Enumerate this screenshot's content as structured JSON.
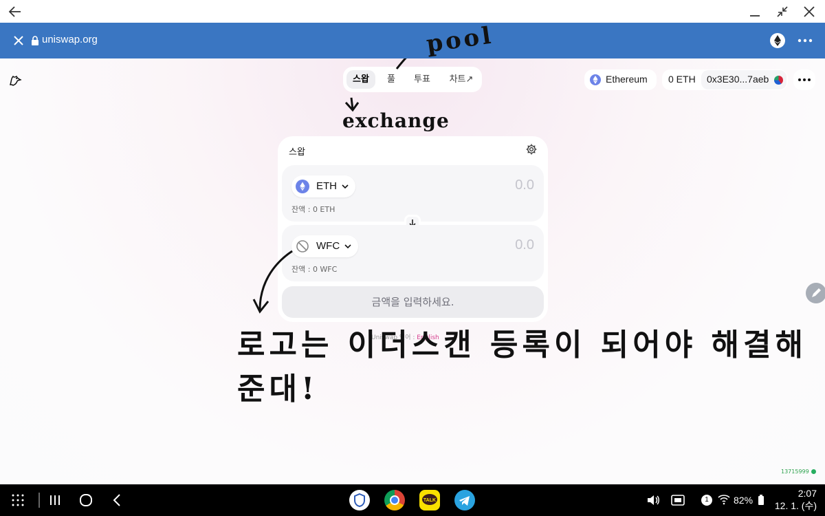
{
  "browser": {
    "url": "uniswap.org",
    "close_icon": "close-icon",
    "lock_icon": "lock-icon"
  },
  "nav": {
    "tabs": [
      {
        "label": "스왑",
        "active": true
      },
      {
        "label": "풀",
        "active": false
      },
      {
        "label": "투표",
        "active": false
      },
      {
        "label": "차트↗",
        "active": false
      }
    ]
  },
  "header": {
    "network": "Ethereum",
    "eth_balance": "0 ETH",
    "address": "0x3E30...7aeb"
  },
  "swap": {
    "title": "스왑",
    "from": {
      "symbol": "ETH",
      "amount": "0.0",
      "balance": "잔액 : 0 ETH"
    },
    "to": {
      "symbol": "WFC",
      "amount": "0.0",
      "balance": "잔액 : 0 WFC"
    },
    "cta": "금액을 입력하세요."
  },
  "footer": {
    "prefix": "Uniswap 언어 : ",
    "language": "English"
  },
  "build": "13715999",
  "annotations": {
    "pool": "pool",
    "exchange": "exchange",
    "note": "로고는 이더스캔 등록이 되어야 해결해준대!"
  },
  "statusbar": {
    "notification_count": "1",
    "battery": "82%",
    "time": "2:07",
    "date": "12. 1. (수)"
  },
  "colors": {
    "browser_bar": "#3a76c2",
    "eth_icon": "#6c83e8",
    "accent_pink": "#d63d8e"
  }
}
